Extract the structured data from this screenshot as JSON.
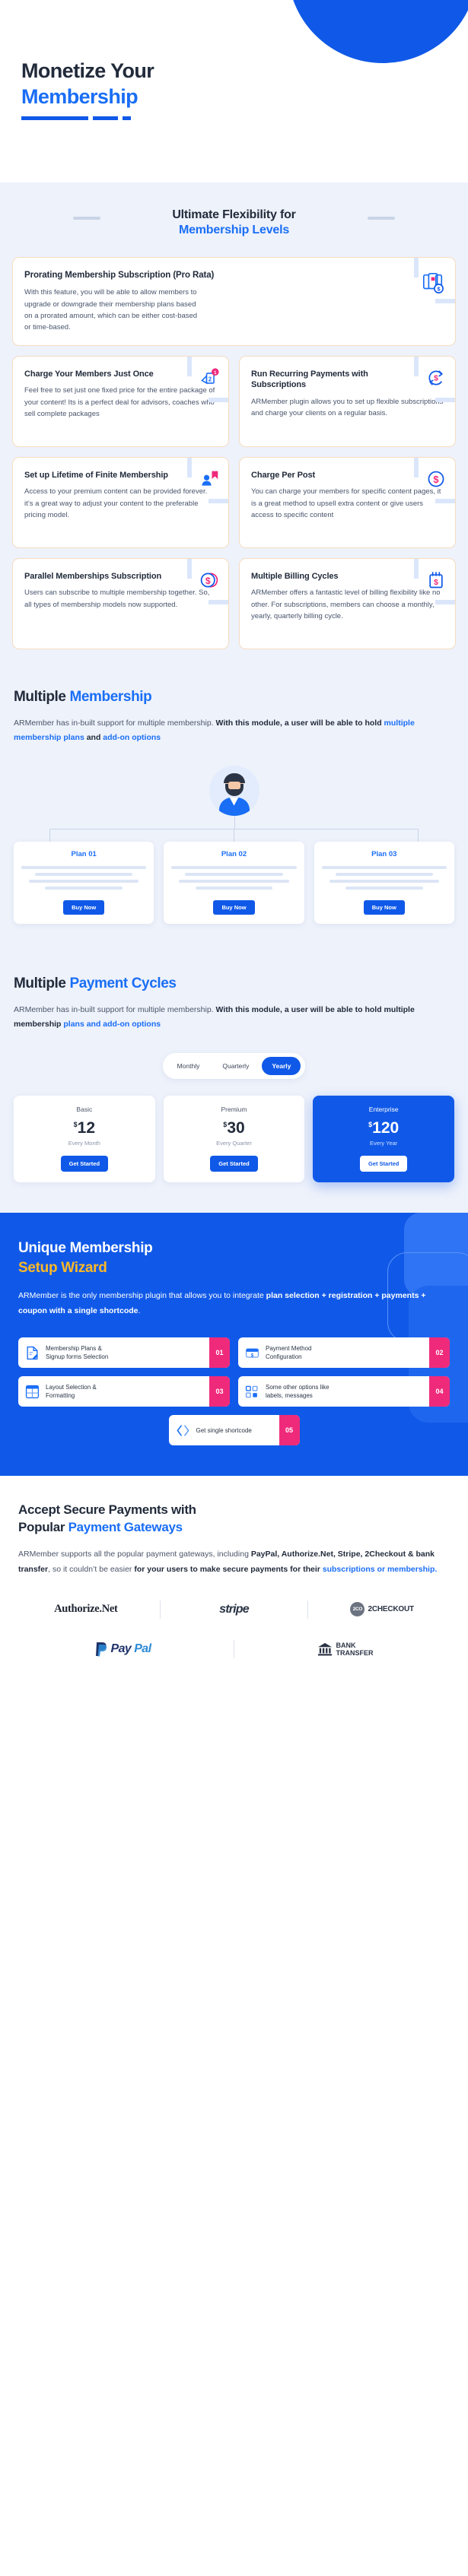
{
  "hero": {
    "line1": "Monetize Your",
    "line2": "Membership"
  },
  "flexibility": {
    "heading_line1": "Ultimate Flexibility for",
    "heading_line2": "Membership Levels",
    "wide_card": {
      "title": "Prorating Membership Subscription (Pro Rata)",
      "text": "With this feature, you will be able to allow members to upgrade or downgrade their membership plans based on a prorated amount, which can be either cost-based or time-based.",
      "icon": "calendar-money-icon"
    },
    "cards": [
      {
        "title": "Charge Your Members Just Once",
        "text": "Feel free to set just one fixed price for the entire package of your  content! Its is a perfect deal for advisors, coaches who sell complete packages",
        "icon": "one-time-payment-icon"
      },
      {
        "title": "Run Recurring Payments with Subscriptions",
        "text": "ARMember plugin allows you to set up flexible subscriptions and charge your clients on a regular basis.",
        "icon": "recurring-dollar-icon"
      },
      {
        "title": "Set up Lifetime of Finite Membership",
        "text": "Access to your premium content can be provided forever. it’s a great way to adjust your content to the preferable pricing model.",
        "icon": "user-bookmark-icon"
      },
      {
        "title": "Charge Per Post",
        "text": "You can charge your members for specific content pages, it is a great method to upsell extra content or give users access to specific content",
        "icon": "dollar-circle-icon"
      },
      {
        "title": "Parallel Memberships Subscription",
        "text": "Users can subscribe to multiple membership together. So, all types of membership models now supported.",
        "icon": "double-coin-dollar-icon"
      },
      {
        "title": "Multiple Billing Cycles",
        "text": "ARMember offers a fantastic level of billing flexibility like no other. For subscriptions, members can choose a monthly, yearly, quarterly billing cycle.",
        "icon": "calendar-dollar-icon"
      }
    ]
  },
  "multiple_membership": {
    "heading_plain": "Multiple ",
    "heading_blue": "Membership",
    "para_normal": "ARMember has in-built support for multiple membership. ",
    "para_bold": "With this module, a user will be able to hold ",
    "para_blue1": "multiple membership plans",
    "para_bold2": " and ",
    "para_blue2": "add-on options",
    "avatar": "user-avatar",
    "plans": [
      {
        "title": "Plan 01",
        "cta": "Buy Now"
      },
      {
        "title": "Plan 02",
        "cta": "Buy Now"
      },
      {
        "title": "Plan 03",
        "cta": "Buy Now"
      }
    ]
  },
  "payment_cycles": {
    "heading_plain": "Multiple ",
    "heading_blue": "Payment Cycles",
    "para_normal": "ARMember has in-built support for multiple membership. ",
    "para_bold": "With this module, a user will be able to hold multiple membership ",
    "para_blue": "plans and add-on options",
    "toggle": {
      "options": [
        "Monthly",
        "Quarterly",
        "Yearly"
      ],
      "selected": "Yearly"
    },
    "plans": [
      {
        "name": "Basic",
        "currency": "$",
        "amount": "12",
        "period": "Every Month",
        "cta": "Get Started",
        "highlight": false
      },
      {
        "name": "Premium",
        "currency": "$",
        "amount": "30",
        "period": "Every Quarter",
        "cta": "Get Started",
        "highlight": false
      },
      {
        "name": "Enterprise",
        "currency": "$",
        "amount": "120",
        "period": "Every Year",
        "cta": "Get Started",
        "highlight": true
      }
    ]
  },
  "wizard": {
    "heading_white": "Unique Membership",
    "heading_yellow": "Setup Wizard",
    "para_normal": "ARMember is the only membership plugin that allows you to integrate ",
    "para_bold": "plan selection + registration + payments + coupon with a single shortcode",
    "para_tail": ".",
    "steps": [
      {
        "label": "Membership Plans &\nSignup forms Selection",
        "number": "01",
        "icon": "document-edit-icon"
      },
      {
        "label": "Payment Method\nConfiguration",
        "number": "02",
        "icon": "card-dollar-icon"
      },
      {
        "label": "Layout Selection &\nFormatting",
        "number": "03",
        "icon": "layout-grid-icon"
      },
      {
        "label": "Some other options like\nlabels, messages",
        "number": "04",
        "icon": "checkbox-list-icon"
      }
    ],
    "final_step": {
      "label": "Get single shortcode",
      "number": "05",
      "icon": "code-brackets-icon"
    },
    "accent_number_color": "#ef2a7b",
    "accent_heading_color": "#fcb827"
  },
  "gateways": {
    "heading_line1": "Accept Secure Payments with",
    "heading_line2_plain": "Popular ",
    "heading_line2_blue": "Payment Gateways",
    "para_normal1": "ARMember supports all the popular payment gateways, including ",
    "para_bold1": "PayPal, Authorize.Net, Stripe, 2Checkout & bank transfer",
    "para_normal2": ", so it couldn’t be easier ",
    "para_bold2": "for your users to make secure payments for their ",
    "para_blue": "subscriptions or membership.",
    "logos_row1": [
      "Authorize.Net",
      "stripe",
      "2CHECKOUT"
    ],
    "logos_row2": [
      "PayPal",
      "BANK TRANSFER"
    ],
    "twocheckout_ring": "2CO",
    "bank_line1": "BANK",
    "bank_line2": "TRANSFER",
    "paypal_part1": "Pay",
    "paypal_part2": "Pal"
  },
  "colors": {
    "brand_blue": "#1059e8",
    "link_blue": "#1a6ef5",
    "accent_pink": "#ef2a7b",
    "accent_yellow": "#fcb827",
    "bg_light": "#eef2fb",
    "card_border": "#f6dcc0",
    "dark_text": "#222b3b"
  }
}
